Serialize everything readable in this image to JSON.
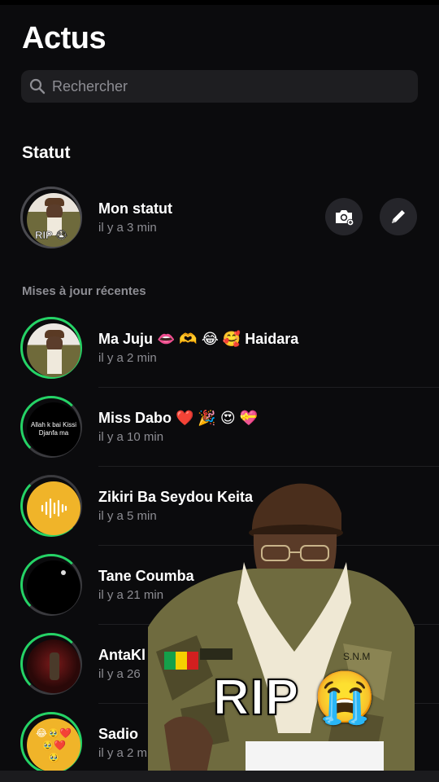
{
  "header": {
    "title": "Actus"
  },
  "search": {
    "placeholder": "Rechercher"
  },
  "status": {
    "section_title": "Statut",
    "my_status": {
      "name": "Mon statut",
      "time": "il y a 3 min",
      "badge": "RIP 😭"
    },
    "actions": {
      "camera_icon": "camera-icon",
      "pencil_icon": "pencil-icon"
    }
  },
  "recent": {
    "title": "Mises à jour récentes",
    "items": [
      {
        "name": "Ma Juju 👄 🫶 😂 🥰 Haidara",
        "time": "il y a 2 min",
        "thumb_text": ""
      },
      {
        "name": "Miss Dabo ❤️ 🎉 😍 💝",
        "time": "il y a 10 min",
        "thumb_text": "Allah k bai Kissi Djanfa ma"
      },
      {
        "name": "Zikiri Ba Seydou Keita",
        "time": "il y a 5 min",
        "thumb_text": ""
      },
      {
        "name": "Tane Coumba",
        "time": "il y a 21 min",
        "thumb_text": ""
      },
      {
        "name": "AntaKl",
        "time": "il y a 26",
        "thumb_text": ""
      },
      {
        "name": "Sadio",
        "time": "il y a 2 m",
        "thumb_text": "😂🥹❤️🥹❤️🥹"
      }
    ]
  },
  "overlay": {
    "caption": "RIP 😭",
    "patch_text": "S.N.M"
  },
  "colors": {
    "ring": "#25d366",
    "ring_seen": "#3a3a3e",
    "background": "#0b0b0d",
    "secondary": "#8d8d93",
    "accent_yellow": "#f0b429"
  }
}
